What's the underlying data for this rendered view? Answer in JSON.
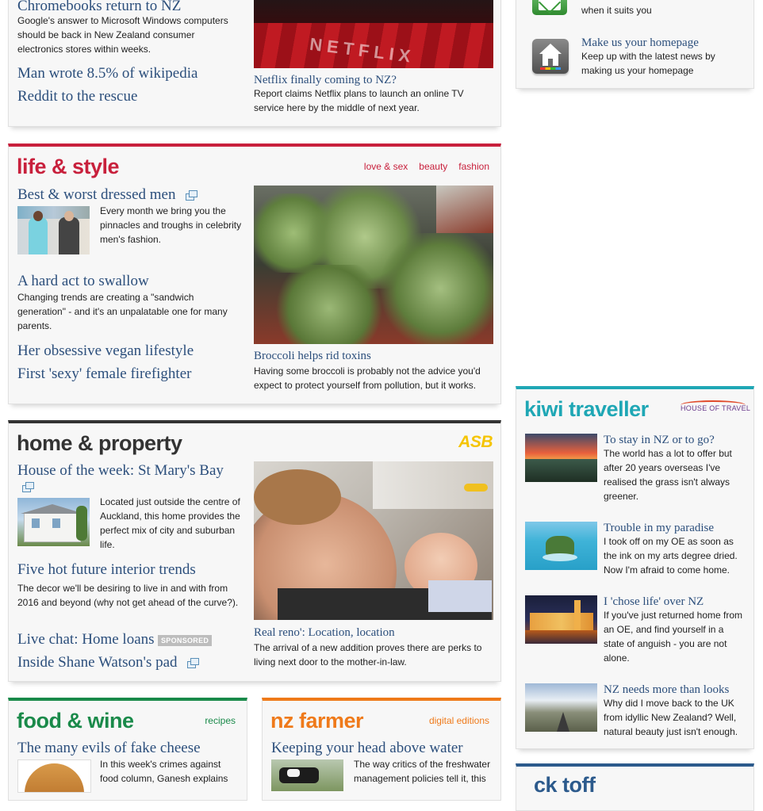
{
  "tech": {
    "top_headline": "Chromebooks return to NZ",
    "top_summary": "Google's answer to Microsoft Windows computers should be back in New Zealand consumer electronics stores within weeks.",
    "links": [
      "Man wrote 8.5% of wikipedia",
      "Reddit to the rescue"
    ],
    "feature_headline": "Netflix finally coming to NZ?",
    "feature_summary": "Report claims Netflix plans to launch an online TV service here by the middle of next year.",
    "feature_image_text": "NETFLIX"
  },
  "sidebar_promos": {
    "email_text": "when it suits you",
    "homepage_title": "Make us your homepage",
    "homepage_text": "Keep up with the latest news by making us your homepage"
  },
  "life_style": {
    "title": "life & style",
    "tags": [
      "love & sex",
      "beauty",
      "fashion"
    ],
    "story1_headline": "Best & worst dressed men",
    "story1_summary": "Every month we bring you the pinnacles and troughs in celebrity men's fashion.",
    "story2_headline": "A hard act to swallow",
    "story2_summary": "Changing trends are creating a \"sandwich generation\" - and it's an unpalatable one for many parents.",
    "links": [
      "Her obsessive vegan lifestyle",
      "First 'sexy' female firefighter"
    ],
    "feature_headline": "Broccoli helps rid toxins",
    "feature_summary": "Having some broccoli is probably not the advice you'd expect to protect yourself from pollution, but it works."
  },
  "home_property": {
    "title": "home & property",
    "sponsor": "ASB",
    "story1_headline": "House of the week: St Mary's Bay",
    "story1_summary": "Located just outside the centre of Auckland, this home provides the perfect mix of city and suburban life.",
    "story2_headline": "Five hot future interior trends",
    "story2_summary": "The decor we'll be desiring to live in and with from 2016 and beyond (why not get ahead of the curve?).",
    "link1": "Live chat: Home loans",
    "sponsored_label": "SPONSORED",
    "link2": "Inside Shane Watson's pad",
    "feature_headline": "Real reno': Location, location",
    "feature_summary": "The arrival of a new addition proves there are perks to living next door to the mother-in-law."
  },
  "food_wine": {
    "title": "food & wine",
    "tag": "recipes",
    "headline": "The many evils of fake cheese",
    "summary": "In this week's crimes against food column, Ganesh explains"
  },
  "nz_farmer": {
    "title": "nz farmer",
    "tag": "digital editions",
    "headline": "Keeping your head above water",
    "summary": "The way critics of the freshwater management policies tell it, this"
  },
  "kiwi_traveller": {
    "title": "kiwi traveller",
    "sponsor": "HOUSE OF TRAVEL",
    "stories": [
      {
        "headline": "To stay in NZ or to go?",
        "summary": "The world has a lot to offer but after 20 years overseas I've realised the grass isn't always greener."
      },
      {
        "headline": "Trouble in my paradise",
        "summary": "I took off on my OE as soon as the ink on my arts degree dried. Now I'm afraid to come home."
      },
      {
        "headline": "I 'chose life' over NZ",
        "summary": "If you've just returned home from an OE, and find yourself in a state of anguish - you are not alone."
      },
      {
        "headline": "NZ needs more than looks",
        "summary": "Why did I move back to the UK from idyllic New Zealand? Well, natural beauty just isn't enough."
      }
    ]
  },
  "next_section": {
    "title": "ck toff"
  },
  "colors": {
    "link": "#2c4f7c",
    "life_style": "#c8203c",
    "home_property": "#333333",
    "asb": "#f5c400",
    "food_wine": "#1a8a4a",
    "nz_farmer": "#ef7a1a",
    "kiwi_traveller": "#1fa7b5",
    "next_section": "#2c5a8c"
  },
  "icons": [
    "email-icon",
    "home-icon",
    "gallery-icon"
  ]
}
